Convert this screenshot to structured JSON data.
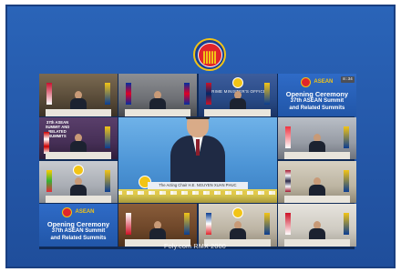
{
  "tiles": {
    "t1": {
      "caption": ""
    },
    "t2": {
      "caption": ""
    },
    "t3": {
      "caption": "PRIME MINISTER'S OFFICE"
    },
    "t4": {
      "brand": "ASEAN",
      "line1": "Opening Ceremony",
      "line2a": "37th ASEAN Summit",
      "line2b": "and Related Summits",
      "badge": "8:34"
    },
    "t5": {
      "summit": "37th ASEAN SUMMIT AND RELATED SUMMITS"
    },
    "t8": {
      "name": ""
    },
    "t12": {
      "name": ""
    },
    "t13": {
      "brand": "ASEAN",
      "line1": "Opening Ceremony",
      "line2a": "37th ASEAN Summit",
      "line2b": "and Related Summits"
    }
  },
  "main": {
    "placard": "The Acting Chair H.E. NGUYEN XUAN PHUC"
  },
  "watermark": "Foly.com RMX 2000",
  "colors": {
    "frame": "#2457a8",
    "emblem_red": "#e0252b",
    "emblem_yellow": "#f2c416"
  }
}
